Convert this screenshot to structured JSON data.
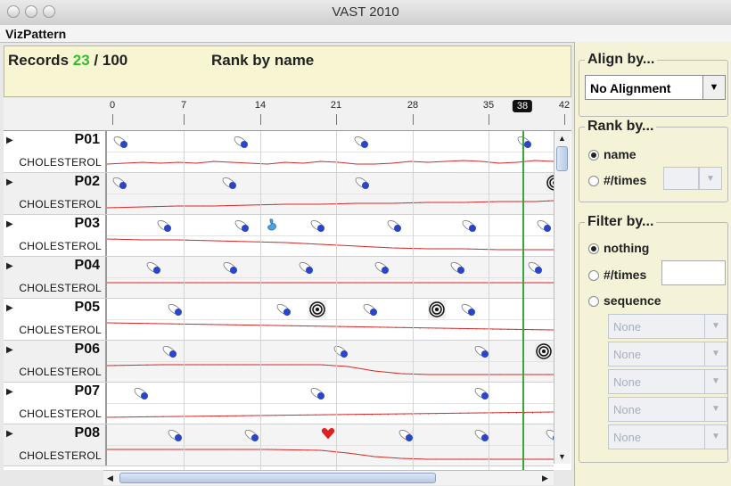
{
  "window": {
    "title": "VAST 2010"
  },
  "menu": {
    "app": "VizPattern"
  },
  "info": {
    "records_label": "Records",
    "records_shown": "23",
    "records_total": "/ 100",
    "rank_label": "Rank by name"
  },
  "axis": {
    "ticks": [
      "0",
      "7",
      "14",
      "21",
      "28",
      "35",
      "42"
    ],
    "current": "38"
  },
  "rows": [
    {
      "id": "P01",
      "metric": "CHOLESTEROL"
    },
    {
      "id": "P02",
      "metric": "CHOLESTEROL"
    },
    {
      "id": "P03",
      "metric": "CHOLESTEROL"
    },
    {
      "id": "P04",
      "metric": "CHOLESTEROL"
    },
    {
      "id": "P05",
      "metric": "CHOLESTEROL"
    },
    {
      "id": "P06",
      "metric": "CHOLESTEROL"
    },
    {
      "id": "P07",
      "metric": "CHOLESTEROL"
    },
    {
      "id": "P08",
      "metric": "CHOLESTEROL"
    }
  ],
  "sidebar": {
    "align": {
      "title": "Align by...",
      "selected": "No Alignment"
    },
    "rank": {
      "title": "Rank by...",
      "options": [
        "name",
        "#/times"
      ],
      "selected": "name"
    },
    "filter": {
      "title": "Filter by...",
      "options": [
        "nothing",
        "#/times",
        "sequence"
      ],
      "selected": "nothing",
      "sequence_values": [
        "None",
        "None",
        "None",
        "None",
        "None"
      ]
    }
  },
  "colors": {
    "records_count": "#2fbf2f",
    "now_line": "#3aa63a",
    "series": "#d42b2b",
    "pill_blue": "#2b45c8"
  }
}
